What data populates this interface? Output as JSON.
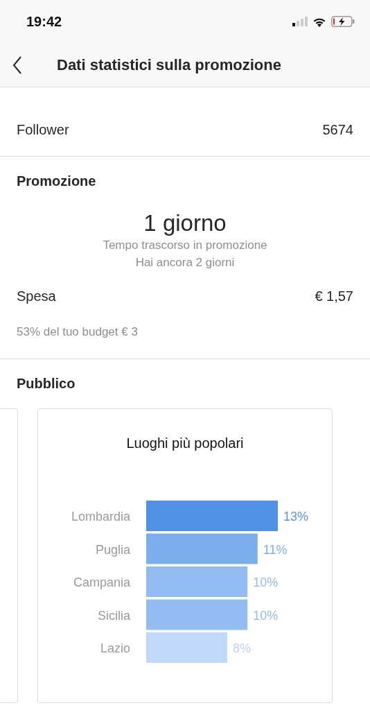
{
  "status_bar": {
    "time": "19:42"
  },
  "nav": {
    "title": "Dati statistici sulla promozione"
  },
  "stats": [
    {
      "label": "Follower",
      "value": "5674"
    }
  ],
  "promotion": {
    "heading": "Promozione",
    "duration": "1 giorno",
    "caption": "Tempo trascorso in promozione",
    "remaining": "Hai ancora 2 giorni",
    "spend_label": "Spesa",
    "spend_value": "€ 1,57",
    "budget_note": "53% del tuo budget € 3"
  },
  "audience": {
    "heading": "Pubblico",
    "card": {
      "title": "Luoghi più popolari",
      "chart_data": {
        "type": "bar",
        "orientation": "horizontal",
        "categories": [
          "Lombardia",
          "Puglia",
          "Campania",
          "Sicilia",
          "Lazio"
        ],
        "values": [
          13,
          11,
          10,
          10,
          8
        ],
        "value_labels": [
          "13%",
          "11%",
          "10%",
          "10%",
          "8%"
        ]
      }
    }
  }
}
